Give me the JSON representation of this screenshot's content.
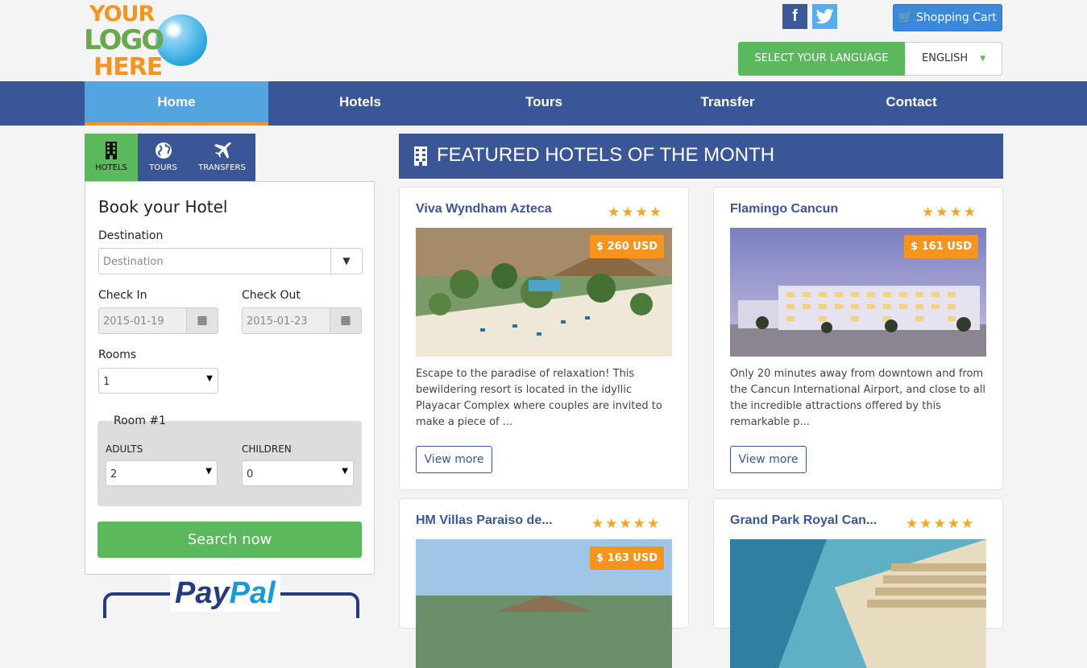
{
  "logo": {
    "line1": "YOUR",
    "line2": "LOGO",
    "line3": "HERE"
  },
  "social": {
    "facebook_icon": "f",
    "twitter_icon": "t"
  },
  "cart": {
    "label": "Shopping Cart",
    "icon": "cart-icon"
  },
  "language": {
    "button_label": "SELECT YOUR LANGUAGE",
    "selected": "ENGLISH"
  },
  "nav": {
    "items": [
      "Home",
      "Hotels",
      "Tours",
      "Transfer",
      "Contact"
    ],
    "active": "Home"
  },
  "search_tabs": [
    {
      "label": "HOTELS",
      "icon": "building-icon",
      "active": true
    },
    {
      "label": "TOURS",
      "icon": "globe-icon",
      "active": false
    },
    {
      "label": "TRANSFERS",
      "icon": "plane-icon",
      "active": false
    }
  ],
  "booking": {
    "title": "Book your Hotel",
    "destination_label": "Destination",
    "destination_placeholder": "Destination",
    "checkin_label": "Check In",
    "checkin_value": "2015-01-19",
    "checkout_label": "Check Out",
    "checkout_value": "2015-01-23",
    "rooms_label": "Rooms",
    "rooms_value": "1",
    "room_title": "Room #1",
    "adults_label": "ADULTS",
    "adults_value": "2",
    "children_label": "CHILDREN",
    "children_value": "0",
    "search_label": "Search now"
  },
  "paypal": {
    "text_a": "Pay",
    "text_b": "Pal"
  },
  "featured": {
    "title": "FEATURED HOTELS OF THE MONTH",
    "view_more_label": "View more",
    "hotels": [
      {
        "name": "Viva Wyndham Azteca",
        "stars": 4,
        "stars_text": "★★★★",
        "price": "$ 260 USD",
        "description": "Escape to the paradise of relaxation! This bewildering resort is located in the idyllic Playacar Complex where couples are invited to make a piece of ..."
      },
      {
        "name": "Flamingo Cancun",
        "stars": 4,
        "stars_text": "★★★★",
        "price": "$ 161 USD",
        "description": "Only 20 minutes away from downtown and from the Cancun International Airport, and close to all the incredible attractions offered by this remarkable p..."
      },
      {
        "name": "HM Villas Paraiso de...",
        "stars": 5,
        "stars_text": "★★★★★",
        "price": "$ 163 USD",
        "description": ""
      },
      {
        "name": "Grand Park Royal Can...",
        "stars": 5,
        "stars_text": "★★★★★",
        "price": "",
        "description": ""
      }
    ]
  },
  "colors": {
    "nav_blue": "#3b5696",
    "active_blue": "#54a4e0",
    "green": "#5cb85c",
    "orange": "#f7941d",
    "star": "#f5a623"
  }
}
